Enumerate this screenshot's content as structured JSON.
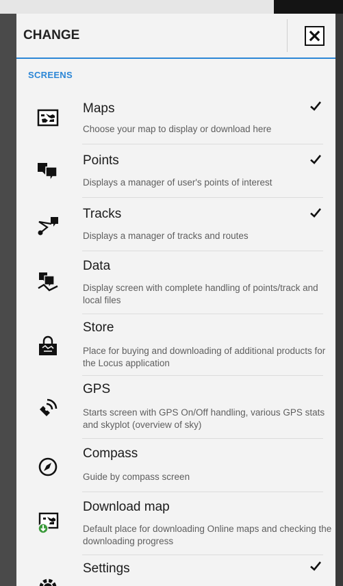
{
  "dialog": {
    "title": "CHANGE",
    "close_icon": "close-icon",
    "section": "SCREENS"
  },
  "items": [
    {
      "title": "Maps",
      "desc": "Choose your map to display or download here",
      "checked": true,
      "icon": "map-icon"
    },
    {
      "title": "Points",
      "desc": "Displays a manager of user's points of interest",
      "checked": true,
      "icon": "points-icon"
    },
    {
      "title": "Tracks",
      "desc": "Displays a manager of tracks and routes",
      "checked": true,
      "icon": "tracks-icon"
    },
    {
      "title": "Data",
      "desc": "Display screen with complete handling of points/track and local files",
      "checked": false,
      "icon": "data-icon"
    },
    {
      "title": "Store",
      "desc": "Place for buying and downloading of additional products for the Locus application",
      "checked": false,
      "icon": "store-icon"
    },
    {
      "title": "GPS",
      "desc": "Starts screen with GPS On/Off handling, various GPS stats and skyplot (overview of sky)",
      "checked": false,
      "icon": "gps-icon"
    },
    {
      "title": "Compass",
      "desc": "Guide by compass screen",
      "checked": false,
      "icon": "compass-icon"
    },
    {
      "title": "Download map",
      "desc": "Default place for downloading Online maps and checking the downloading progress",
      "checked": false,
      "icon": "download-map-icon"
    },
    {
      "title": "Settings",
      "desc": "",
      "checked": true,
      "icon": "settings-icon"
    }
  ]
}
